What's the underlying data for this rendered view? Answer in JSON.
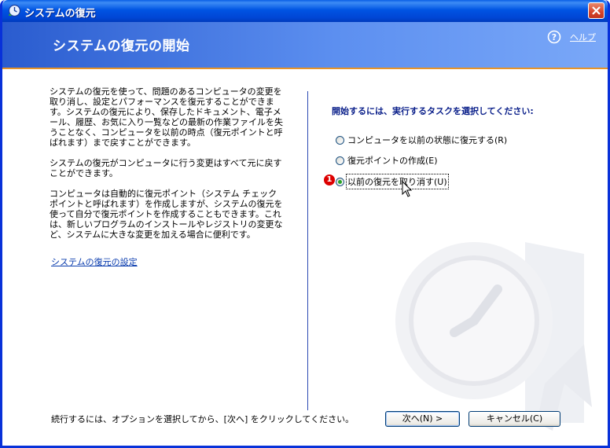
{
  "window": {
    "title": "システムの復元"
  },
  "header": {
    "title": "システムの復元の開始",
    "help_label": "ヘルプ"
  },
  "left": {
    "paragraphs": [
      "システムの復元を使って、問題のあるコンピュータの変更を取り消し、設定とパフォーマンスを復元することができます。システムの復元により、保存したドキュメント、電子メール、履歴、お気に入り一覧などの最新の作業ファイルを失うことなく、コンピュータを以前の時点（復元ポイントと呼ばれます）まで戻すことができます。",
      "システムの復元がコンピュータに行う変更はすべて元に戻すことができます。",
      "コンピュータは自動的に復元ポイント（システム チェックポイントと呼ばれます）を作成しますが、システムの復元を使って自分で復元ポイントを作成することもできます。これは、新しいプログラムのインストールやレジストリの変更など、システムに大きな変更を加える場合に便利です。"
    ],
    "settings_link": "システムの復元の設定"
  },
  "right": {
    "prompt": "開始するには、実行するタスクを選択してください:",
    "options": [
      {
        "label": "コンピュータを以前の状態に復元する(R)",
        "checked": false
      },
      {
        "label": "復元ポイントの作成(E)",
        "checked": false
      },
      {
        "label": "以前の復元を取り消す(U)",
        "checked": true
      }
    ],
    "badge": "1"
  },
  "footer": {
    "instruction": "続行するには、オプションを選択してから、[次へ] をクリックしてください。",
    "next_label": "次へ(N) >",
    "cancel_label": "キャンセル(C)"
  },
  "colors": {
    "title_bar": "#0054e3",
    "header": "#5c8ff0",
    "accent_line": "#e6942a",
    "link": "#0a3cae"
  }
}
